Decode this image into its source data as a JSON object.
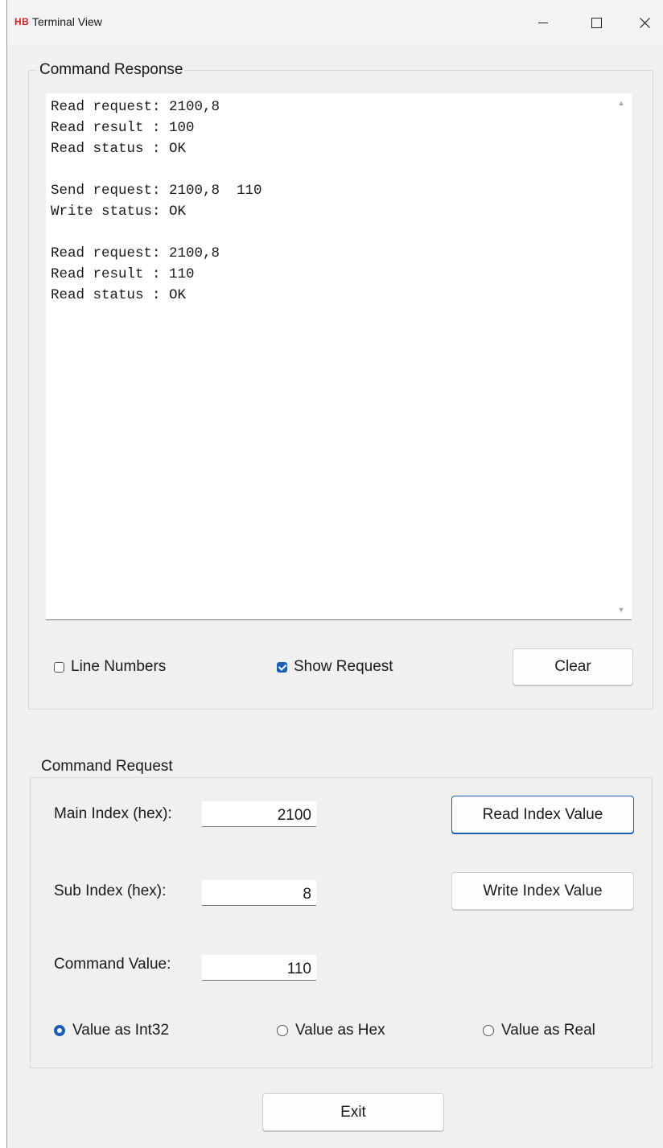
{
  "window": {
    "app_logo": "HB",
    "title": "Terminal View",
    "minimize": "minimize",
    "maximize": "maximize",
    "close": "close"
  },
  "response": {
    "group_label": "Command Response",
    "text": "Read request: 2100,8\nRead result : 100\nRead status : OK\n\nSend request: 2100,8  110\nWrite status: OK\n\nRead request: 2100,8\nRead result : 110\nRead status : OK",
    "line_numbers_label": "Line Numbers",
    "line_numbers_checked": false,
    "show_request_label": "Show Request",
    "show_request_checked": true,
    "clear_label": "Clear"
  },
  "request": {
    "group_label": "Command Request",
    "main_index_label": "Main Index (hex):",
    "main_index_value": "2100",
    "sub_index_label": "Sub Index (hex):",
    "sub_index_value": "8",
    "command_value_label": "Command Value:",
    "command_value_value": "110",
    "read_button_label": "Read Index Value",
    "write_button_label": "Write Index Value",
    "radio_options": [
      {
        "label": "Value as Int32",
        "selected": true
      },
      {
        "label": "Value as Hex",
        "selected": false
      },
      {
        "label": "Value as Real",
        "selected": false
      }
    ]
  },
  "exit_label": "Exit",
  "colors": {
    "accent": "#1a5fb4",
    "logo": "#d42020",
    "window_bg": "#f0f0f0"
  }
}
